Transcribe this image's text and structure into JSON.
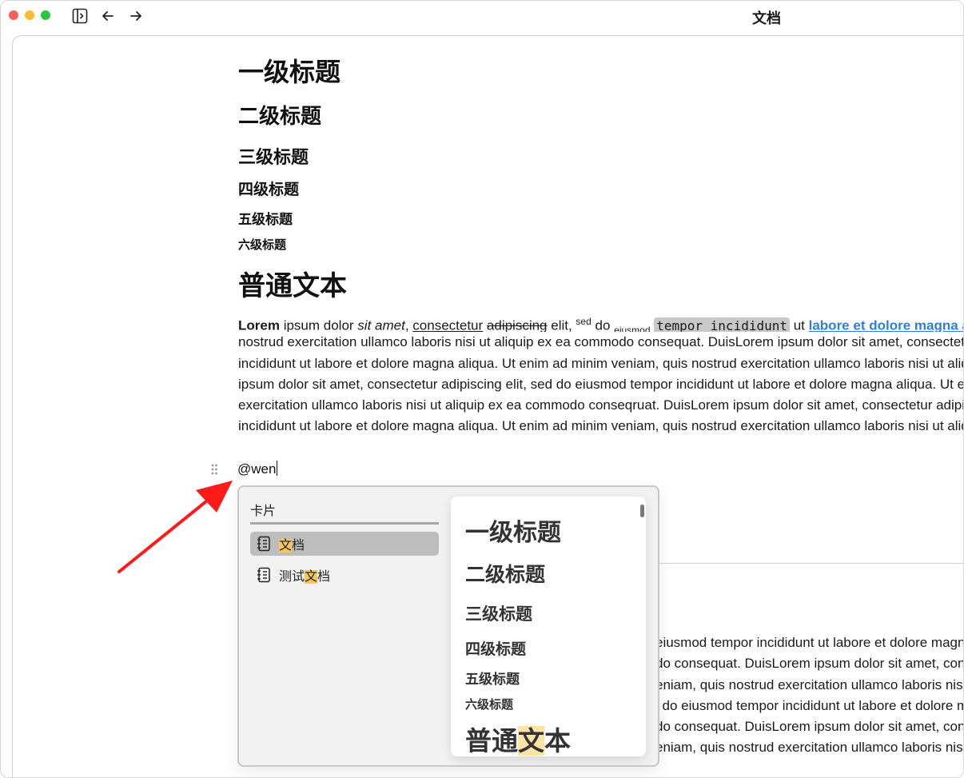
{
  "window": {
    "title": "文档"
  },
  "doc": {
    "headings": [
      "一级标题",
      "二级标题",
      "三级标题",
      "四级标题",
      "五级标题",
      "六级标题",
      "普通文本"
    ],
    "paragraph": {
      "w_bold": "Lorem",
      "w_plain1": " ipsum dolor ",
      "w_italic": "sit amet",
      "w_comma1": ", ",
      "w_underline": "consectetur",
      "w_space1": " ",
      "w_strike": "adipiscing",
      "w_elit": " elit, ",
      "w_sup": "sed",
      "w_do": " do ",
      "w_sub": "eiusmod",
      "w_space2": " ",
      "w_code": "tempor incididunt",
      "w_ut": " ut ",
      "w_link": "labore et dolore magna aliqua",
      "lines": [
        "nostrud exercitation ullamco laboris nisi ut aliquip ex ea commodo consequat. DuisLorem ipsum dolor sit amet, consectetur adipiscing elit, sed do eiusmod tempor",
        "incididunt ut labore et dolore magna aliqua. Ut enim ad minim veniam, quis nostrud exercitation ullamco laboris nisi ut aliquip ex ea commodo consequat. DuisLorem",
        "ipsum dolor sit amet, consectetur adipiscing elit, sed do eiusmod tempor incididunt ut labore et dolore magna aliqua. Ut enim ad minim veniam, quis nostrud",
        "exercitation ullamco laboris nisi ut aliquip ex ea commodo conseqruat. DuisLorem ipsum dolor sit amet, consectetur adipiscing elit, sed do eiusmod tempor",
        "incididunt ut labore et dolore magna aliqua. Ut enim ad minim veniam, quis nostrud exercitation ullamco laboris nisi ut aliquip ex ea commodo consequat."
      ]
    },
    "mention_input": "@wen",
    "background_lines": [
      "eiusmod tempor incididunt ut labore et dolore magna aliqua",
      "do consequat. DuisLorem ipsum dolor sit amet, consectetur",
      "eniam, quis nostrud exercitation ullamco laboris nisi ut",
      "l do eiusmod tempor incididunt ut labore et dolore magna",
      "do consequat. DuisLorem ipsum dolor sit amet, consectetur",
      "eniam, quis nostrud exercitation ullamco laboris nisi ut"
    ]
  },
  "popup": {
    "header": "卡片",
    "items": [
      {
        "before": "",
        "highlight": "文",
        "after": "档",
        "icon": "notebook-icon",
        "selected": true
      },
      {
        "before": "测试",
        "highlight": "文",
        "after": "档",
        "icon": "notebook-icon",
        "selected": false
      }
    ],
    "preview": {
      "headings": [
        "一级标题",
        "二级标题",
        "三级标题",
        "四级标题",
        "五级标题",
        "六级标题"
      ],
      "last_before": "普通",
      "last_highlight": "文",
      "last_after": "本"
    }
  },
  "colors": {
    "accent_link": "#2f7de1",
    "highlight": "#f7c75a",
    "preview_highlight": "#fde3a4",
    "traffic_red": "#ff5f57",
    "traffic_yellow": "#febc2e",
    "traffic_green": "#28c840",
    "annotation_arrow": "#ff1a1a"
  }
}
